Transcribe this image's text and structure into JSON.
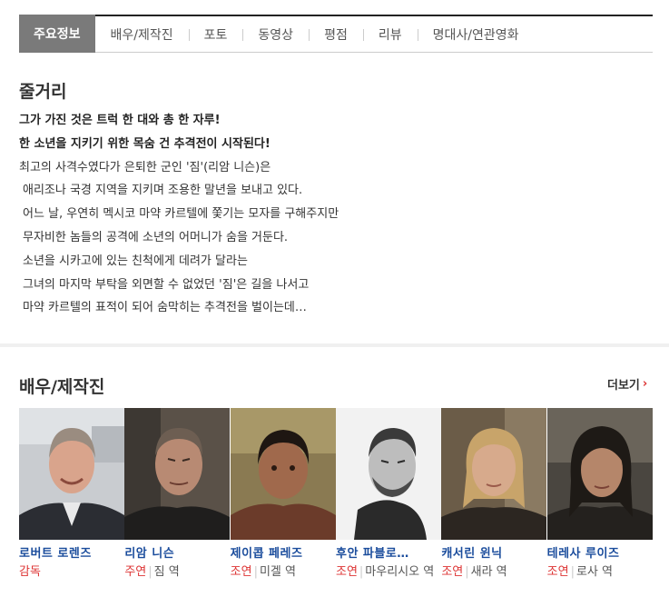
{
  "tabs": [
    {
      "label": "주요정보",
      "active": true
    },
    {
      "label": "배우/제작진",
      "active": false
    },
    {
      "label": "포토",
      "active": false
    },
    {
      "label": "동영상",
      "active": false
    },
    {
      "label": "평점",
      "active": false
    },
    {
      "label": "리뷰",
      "active": false
    },
    {
      "label": "명대사/연관영화",
      "active": false
    }
  ],
  "synopsis": {
    "title": "줄거리",
    "headline1": "그가 가진 것은 트럭 한 대와 총 한 자루!",
    "headline2": "한 소년을 지키기 위한 목숨 건 추격전이 시작된다!",
    "lines": [
      "최고의 사격수였다가 은퇴한 군인 '짐'(리암 니슨)은",
      " 애리조나 국경 지역을 지키며 조용한 말년을 보내고 있다.",
      " 어느 날, 우연히 멕시코 마약 카르텔에 쫓기는 모자를 구해주지만",
      " 무자비한 놈들의 공격에 소년의 어머니가 숨을 거둔다.",
      " 소년을 시카고에 있는 친척에게 데려가 달라는",
      " 그녀의 마지막 부탁을 외면할 수 없었던 '짐'은 길을 나서고",
      " 마약 카르텔의 표적이 되어 숨막히는 추격전을 벌이는데…"
    ]
  },
  "cast_section": {
    "title": "배우/제작진",
    "more_label": "더보기",
    "more_arrow": "›",
    "members": [
      {
        "name": "로버트 로렌즈",
        "role": "감독",
        "character": ""
      },
      {
        "name": "리암 니슨",
        "role": "주연",
        "character": "짐 역"
      },
      {
        "name": "제이콥 페레즈",
        "role": "조연",
        "character": "미겔 역"
      },
      {
        "name": "후안 파블로…",
        "role": "조연",
        "character": "마우리시오 역"
      },
      {
        "name": "캐서린 윈닉",
        "role": "조연",
        "character": "새라 역"
      },
      {
        "name": "테레사 루이즈",
        "role": "조연",
        "character": "로사 역"
      }
    ]
  },
  "colors": {
    "accent_red": "#dd3333",
    "link_blue": "#1a4c9c",
    "active_tab": "#7a7a7a"
  }
}
